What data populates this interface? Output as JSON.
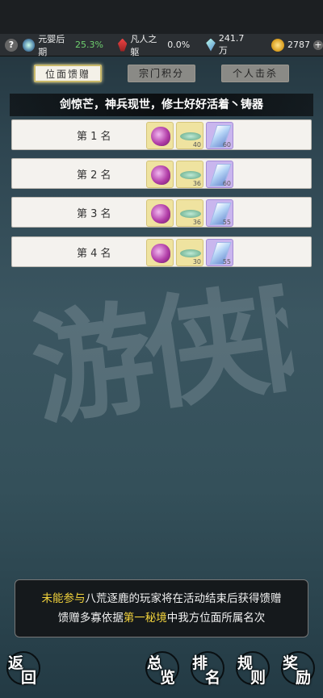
{
  "status": {
    "help_label": "?",
    "realm": "元婴后期",
    "realm_pct": "25.3%",
    "body": "凡人之躯",
    "body_pct": "0.0%",
    "crystals": "241.7万",
    "gold": "2787"
  },
  "tabs": [
    {
      "label": "位面馈赠"
    },
    {
      "label": "宗门积分"
    },
    {
      "label": "个人击杀"
    }
  ],
  "banner": "剑惊芒，神兵现世，修士好好活着丶铸器",
  "ranks": [
    {
      "label": "第 1 名",
      "rewards": [
        "",
        "40",
        "60"
      ]
    },
    {
      "label": "第 2 名",
      "rewards": [
        "",
        "36",
        "60"
      ]
    },
    {
      "label": "第 3 名",
      "rewards": [
        "",
        "36",
        "55"
      ]
    },
    {
      "label": "第 4 名",
      "rewards": [
        "",
        "30",
        "55"
      ]
    }
  ],
  "notice": {
    "l1a": "未能参与",
    "l1b": "八荒逐鹿的玩家将在活动结束后获得馈赠",
    "l2a": "馈赠多寡依据",
    "l2b": "第一秘境",
    "l2c": "中我方位面所属名次"
  },
  "bottom": {
    "back": [
      "返",
      "回"
    ],
    "overview": [
      "总",
      "览"
    ],
    "rank": [
      "排",
      "名"
    ],
    "rules": [
      "规",
      "则"
    ],
    "reward": [
      "奖",
      "励"
    ]
  }
}
